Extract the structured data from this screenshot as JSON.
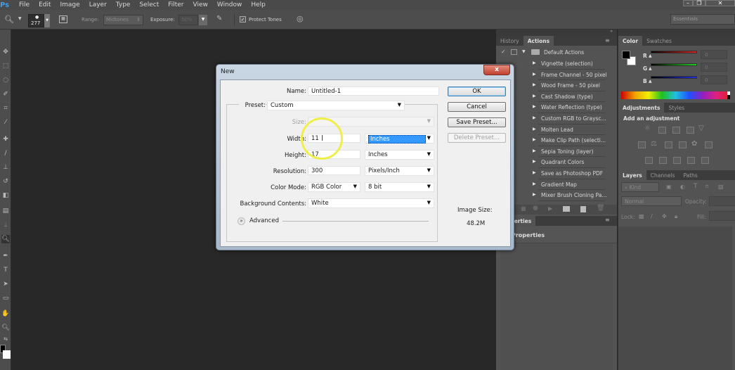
{
  "app": {
    "logo": "Ps",
    "menus": [
      "File",
      "Edit",
      "Image",
      "Layer",
      "Type",
      "Select",
      "Filter",
      "View",
      "Window",
      "Help"
    ],
    "window_controls": [
      "minimize",
      "restore",
      "close"
    ]
  },
  "options_bar": {
    "brush_size": "277",
    "range_label": "Range:",
    "range_value": "Midtones",
    "exposure_label": "Exposure:",
    "exposure_value": "50%",
    "protect_tones_label": "Protect Tones",
    "protect_tones_checked": true,
    "workspace": "Essentials"
  },
  "tools": [
    "move",
    "marquee",
    "lasso",
    "quick-select",
    "crop",
    "eyedropper",
    "healing-brush",
    "brush",
    "clone-stamp",
    "history-brush",
    "eraser",
    "gradient",
    "blur",
    "dodge",
    "pen",
    "type",
    "path-select",
    "shape",
    "hand",
    "zoom",
    "swap-colors"
  ],
  "dialog": {
    "title": "New",
    "close": "x",
    "name_label": "Name:",
    "name_value": "Untitled-1",
    "preset_label": "Preset:",
    "preset_value": "Custom",
    "size_label": "Size:",
    "size_value": "",
    "width_label": "Width:",
    "width_value": "11",
    "width_unit": "Inches",
    "height_label": "Height:",
    "height_value": "17",
    "height_unit": "Inches",
    "resolution_label": "Resolution:",
    "resolution_value": "300",
    "resolution_unit": "Pixels/Inch",
    "color_mode_label": "Color Mode:",
    "color_mode_value": "RGB Color",
    "bit_depth": "8 bit",
    "bg_label": "Background Contents:",
    "bg_value": "White",
    "advanced_label": "Advanced",
    "image_size_label": "Image Size:",
    "image_size_value": "48.2M",
    "buttons": {
      "ok": "OK",
      "cancel": "Cancel",
      "save_preset": "Save Preset...",
      "delete_preset": "Delete Preset..."
    }
  },
  "actions_panel": {
    "tabs": [
      "History",
      "Actions"
    ],
    "active_tab": "Actions",
    "set_name": "Default Actions",
    "items": [
      "Vignette (selection)",
      "Frame Channel - 50 pixel",
      "Wood Frame - 50 pixel",
      "Cast Shadow (type)",
      "Water Reflection (type)",
      "Custom RGB to Graysc...",
      "Molten Lead",
      "Make Clip Path (selecti...",
      "Sepia Toning (layer)",
      "Quadrant Colors",
      "Save as Photoshop PDF",
      "Gradient Map",
      "Mixer Brush Cloning Pa..."
    ]
  },
  "properties_panel": {
    "tab": "Properties",
    "title": "Properties"
  },
  "color_panel": {
    "tabs": [
      "Color",
      "Swatches"
    ],
    "active_tab": "Color",
    "channels": [
      {
        "label": "R",
        "value": "0",
        "color": "#e02020"
      },
      {
        "label": "G",
        "value": "0",
        "color": "#20d020"
      },
      {
        "label": "B",
        "value": "0",
        "color": "#2030e0"
      }
    ],
    "foreground": "#000000",
    "background": "#ffffff"
  },
  "adjustments_panel": {
    "tabs": [
      "Adjustments",
      "Styles"
    ],
    "active_tab": "Adjustments",
    "heading": "Add an adjustment"
  },
  "layers_panel": {
    "tabs": [
      "Layers",
      "Channels",
      "Paths"
    ],
    "active_tab": "Layers",
    "filter_kind": "Kind",
    "blend_mode": "Normal",
    "opacity_label": "Opacity:",
    "lock_label": "Lock:",
    "fill_label": "Fill:"
  }
}
